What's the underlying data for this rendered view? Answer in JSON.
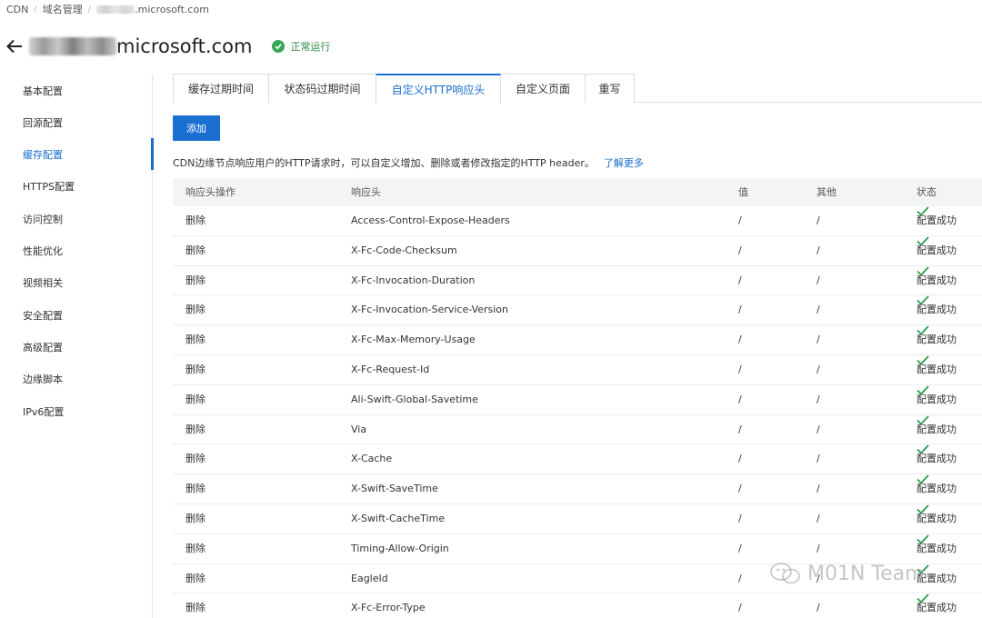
{
  "breadcrumb": {
    "root": "CDN",
    "domain_mgmt": "域名管理",
    "domain_suffix": ".microsoft.com"
  },
  "header": {
    "domain_suffix": "microsoft.com",
    "status": "正常运行",
    "status_color": "#3aa65a"
  },
  "sidebar": {
    "items": [
      {
        "label": "基本配置"
      },
      {
        "label": "回源配置"
      },
      {
        "label": "缓存配置"
      },
      {
        "label": "HTTPS配置"
      },
      {
        "label": "访问控制"
      },
      {
        "label": "性能优化"
      },
      {
        "label": "视频相关"
      },
      {
        "label": "安全配置"
      },
      {
        "label": "高级配置"
      },
      {
        "label": "边缘脚本"
      },
      {
        "label": "IPv6配置"
      }
    ],
    "active_index": 2
  },
  "tabs": [
    {
      "label": "缓存过期时间"
    },
    {
      "label": "状态码过期时间"
    },
    {
      "label": "自定义HTTP响应头"
    },
    {
      "label": "自定义页面"
    },
    {
      "label": "重写"
    }
  ],
  "active_tab": 2,
  "add_button": "添加",
  "description": "CDN边缘节点响应用户的HTTP请求时，可以自定义增加、删除或者修改指定的HTTP header。",
  "learn_more": "了解更多",
  "table": {
    "headers": [
      "响应头操作",
      "响应头",
      "值",
      "其他",
      "状态"
    ],
    "rows": [
      {
        "op": "删除",
        "header": "Access-Control-Expose-Headers",
        "value": "/",
        "other": "/",
        "status": "配置成功"
      },
      {
        "op": "删除",
        "header": "X-Fc-Code-Checksum",
        "value": "/",
        "other": "/",
        "status": "配置成功"
      },
      {
        "op": "删除",
        "header": "X-Fc-Invocation-Duration",
        "value": "/",
        "other": "/",
        "status": "配置成功"
      },
      {
        "op": "删除",
        "header": "X-Fc-Invocation-Service-Version",
        "value": "/",
        "other": "/",
        "status": "配置成功"
      },
      {
        "op": "删除",
        "header": "X-Fc-Max-Memory-Usage",
        "value": "/",
        "other": "/",
        "status": "配置成功"
      },
      {
        "op": "删除",
        "header": "X-Fc-Request-Id",
        "value": "/",
        "other": "/",
        "status": "配置成功"
      },
      {
        "op": "删除",
        "header": "Ali-Swift-Global-Savetime",
        "value": "/",
        "other": "/",
        "status": "配置成功"
      },
      {
        "op": "删除",
        "header": "Via",
        "value": "/",
        "other": "/",
        "status": "配置成功"
      },
      {
        "op": "删除",
        "header": "X-Cache",
        "value": "/",
        "other": "/",
        "status": "配置成功"
      },
      {
        "op": "删除",
        "header": "X-Swift-SaveTime",
        "value": "/",
        "other": "/",
        "status": "配置成功"
      },
      {
        "op": "删除",
        "header": "X-Swift-CacheTime",
        "value": "/",
        "other": "/",
        "status": "配置成功"
      },
      {
        "op": "删除",
        "header": "Timing-Allow-Origin",
        "value": "/",
        "other": "/",
        "status": "配置成功"
      },
      {
        "op": "删除",
        "header": "EagleId",
        "value": "/",
        "other": "/",
        "status": "配置成功"
      },
      {
        "op": "删除",
        "header": "X-Fc-Error-Type",
        "value": "/",
        "other": "/",
        "status": "配置成功"
      }
    ]
  },
  "watermark": "M01N Team",
  "accent_color": "#1a6fd1",
  "success_color": "#2e9c4e"
}
